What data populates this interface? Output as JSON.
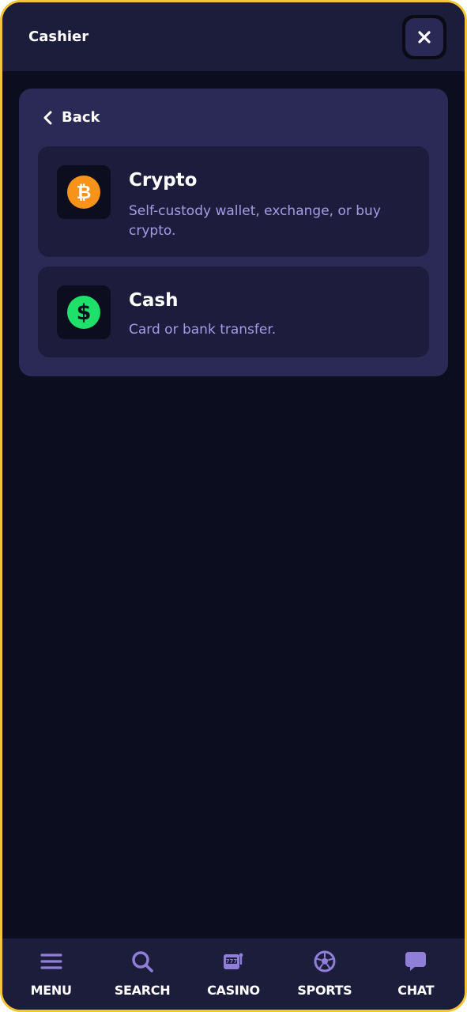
{
  "header": {
    "title": "Cashier",
    "close_icon": "close-icon"
  },
  "panel": {
    "back_label": "Back",
    "options": [
      {
        "title": "Crypto",
        "description": "Self-custody wallet, exchange, or buy crypto.",
        "icon": "bitcoin-icon",
        "icon_color": "#f7931a"
      },
      {
        "title": "Cash",
        "description": "Card or bank transfer.",
        "icon": "dollar-icon",
        "icon_color": "#1fe06a"
      }
    ]
  },
  "bottom_nav": {
    "items": [
      {
        "label": "MENU",
        "icon": "menu-icon"
      },
      {
        "label": "SEARCH",
        "icon": "search-icon"
      },
      {
        "label": "CASINO",
        "icon": "slot-machine-icon"
      },
      {
        "label": "SPORTS",
        "icon": "soccer-ball-icon"
      },
      {
        "label": "CHAT",
        "icon": "chat-bubble-icon"
      }
    ]
  },
  "colors": {
    "frame_border": "#f2c531",
    "background": "#0c0d1e",
    "header": "#1c1c3b",
    "panel": "#2b2a56",
    "option_card": "#1d1c3c",
    "subtext": "#a79be6",
    "nav_icon": "#8f7fd8"
  }
}
